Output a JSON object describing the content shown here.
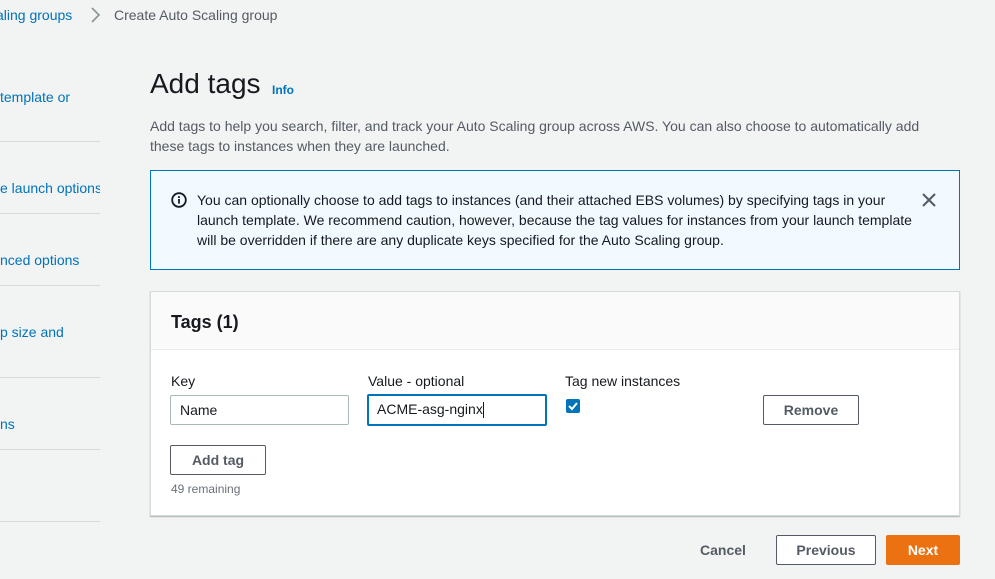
{
  "breadcrumb": {
    "parent": "aling groups",
    "current": "Create Auto Scaling group"
  },
  "steps": [
    {
      "label": "template or"
    },
    {
      "label": "e launch options"
    },
    {
      "label": "nced options"
    },
    {
      "label": "p size and"
    },
    {
      "label": "ns"
    }
  ],
  "page": {
    "title": "Add tags",
    "info": "Info",
    "description": "Add tags to help you search, filter, and track your Auto Scaling group across AWS. You can also choose to automatically add these tags to instances when they are launched."
  },
  "alert": {
    "text": "You can optionally choose to add tags to instances (and their attached EBS volumes) by specifying tags in your launch template. We recommend caution, however, because the tag values for instances from your launch template will be overridden if there are any duplicate keys specified for the Auto Scaling group.",
    "icon": "info-circle-icon",
    "close_icon": "close-icon",
    "accent_color": "#0073bb",
    "background_color": "#f1faff"
  },
  "tags": {
    "title": "Tags (1)",
    "key_label": "Key",
    "value_label": "Value - optional",
    "tag_new_label": "Tag new instances",
    "rows": [
      {
        "key": "Name",
        "value": "ACME-asg-nginx",
        "tag_new_instances": true
      }
    ],
    "remove_label": "Remove",
    "add_label": "Add tag",
    "remaining": "49 remaining"
  },
  "footer": {
    "cancel": "Cancel",
    "previous": "Previous",
    "next": "Next",
    "primary_color": "#ec7211"
  }
}
